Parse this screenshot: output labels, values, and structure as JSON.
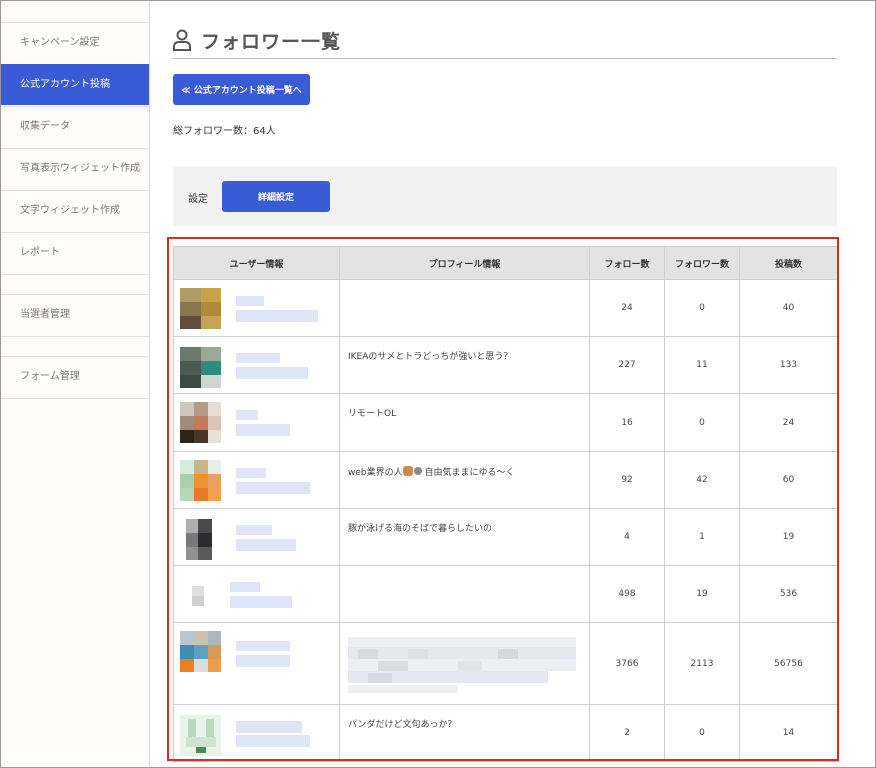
{
  "sidebar": {
    "items": [
      {
        "label": "キャンペーン設定",
        "active": false
      },
      {
        "label": "公式アカウント投稿",
        "active": true
      },
      {
        "label": "収集データ",
        "active": false
      },
      {
        "label": "写真表示ウィジェット作成",
        "active": false
      },
      {
        "label": "文字ウィジェット作成",
        "active": false
      },
      {
        "label": "レポート",
        "active": false
      },
      {
        "label": "当選者管理",
        "active": false
      },
      {
        "label": "フォーム管理",
        "active": false
      }
    ]
  },
  "page": {
    "title": "フォロワー一覧",
    "title_icon": "user-icon",
    "back_button": "≪ 公式アカウント投稿一覧へ",
    "total_followers": "総フォロワー数：64人"
  },
  "settings": {
    "label": "設定",
    "detail_button": "詳細設定"
  },
  "table": {
    "headers": [
      "ユーザー情報",
      "プロフィール情報",
      "フォロー数",
      "フォロワー数",
      "投稿数"
    ],
    "rows": [
      {
        "profile": "",
        "follow": "24",
        "followers": "0",
        "posts": "40"
      },
      {
        "profile": "IKEAのサメとトラどっちが強いと思う？",
        "follow": "227",
        "followers": "11",
        "posts": "133"
      },
      {
        "profile": "リモートOL",
        "follow": "16",
        "followers": "0",
        "posts": "24"
      },
      {
        "profile": "web業界の人",
        "profile_after": " 自由気ままにゆる〜く",
        "follow": "92",
        "followers": "42",
        "posts": "60"
      },
      {
        "profile": "豚が泳げる海のそばで暮らしたいの",
        "follow": "4",
        "followers": "1",
        "posts": "19"
      },
      {
        "profile": "",
        "follow": "498",
        "followers": "19",
        "posts": "536"
      },
      {
        "profile": "",
        "follow": "3766",
        "followers": "2113",
        "posts": "56756"
      },
      {
        "profile": "パンダだけど文句あっか？",
        "follow": "2",
        "followers": "0",
        "posts": "14"
      }
    ]
  },
  "colors": {
    "accent": "#3a5bd6",
    "highlight_border": "#e02a1f",
    "header_bg": "#e3e3e3"
  }
}
